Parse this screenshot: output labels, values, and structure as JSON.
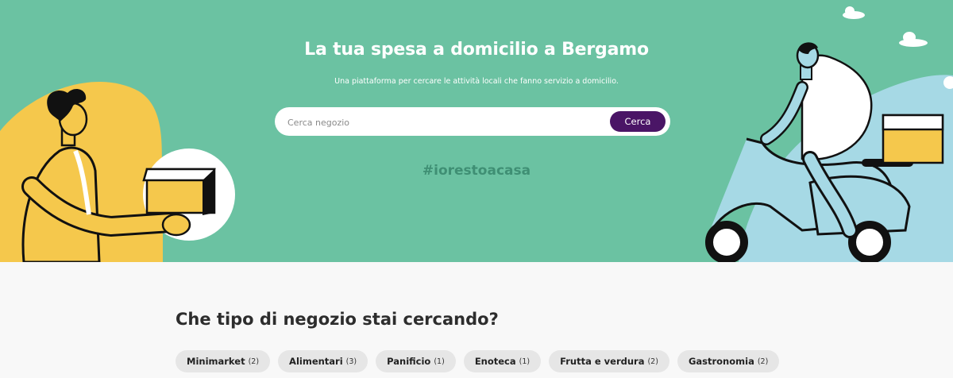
{
  "hero": {
    "title": "La tua spesa a domicilio a Bergamo",
    "subtitle": "Una piattaforma per cercare le attività locali che fanno servizio a domicilio.",
    "search_placeholder": "Cerca negozio",
    "search_button": "Cerca",
    "hashtag": "#iorestoacasa",
    "bg_color": "#6bc2a2",
    "button_color": "#4a1566"
  },
  "categories": {
    "title": "Che tipo di negozio stai cercando?",
    "items": [
      {
        "label": "Minimarket",
        "count": "(2)"
      },
      {
        "label": "Alimentari",
        "count": "(3)"
      },
      {
        "label": "Panificio",
        "count": "(1)"
      },
      {
        "label": "Enoteca",
        "count": "(1)"
      },
      {
        "label": "Frutta e verdura",
        "count": "(2)"
      },
      {
        "label": "Gastronomia",
        "count": "(2)"
      }
    ]
  }
}
